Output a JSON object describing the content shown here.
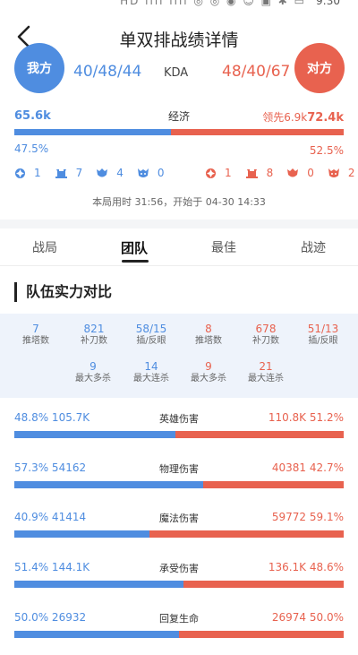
{
  "status_bar": {
    "time": "9:30",
    "icons": "HD ııll ııll ◎ ◎ ◉ ☺ ▣ ✱ ▭"
  },
  "nav": {
    "title": "单双排战绩详情"
  },
  "hero": {
    "ours_label": "我方",
    "theirs_label": "对方",
    "ours_kda": "40/48/44",
    "theirs_kda": "48/40/67",
    "kda_label": "KDA"
  },
  "economy": {
    "label": "经济",
    "ours_value": "65.6k",
    "lead_text": "领先6.9k",
    "theirs_value": "72.4k",
    "ours_pct": "47.5%",
    "theirs_pct": "52.5%",
    "ours_fraction": 0.475
  },
  "objectives": {
    "ours": [
      "1",
      "7",
      "4",
      "0"
    ],
    "theirs": [
      "1",
      "8",
      "0",
      "2"
    ],
    "icon_names": [
      "tyrant-icon",
      "tower-icon",
      "dragon-icon",
      "overlord-icon"
    ]
  },
  "duration_text": "本局用时 31:56，开始于 04-30 14:33",
  "tabs": [
    {
      "label": "战局",
      "active": false
    },
    {
      "label": "团队",
      "active": true
    },
    {
      "label": "最佳",
      "active": false
    },
    {
      "label": "战迹",
      "active": false
    }
  ],
  "section_title": "队伍实力对比",
  "stats": {
    "row1": [
      {
        "value": "7",
        "label": "推塔数",
        "side": "ours"
      },
      {
        "value": "821",
        "label": "补刀数",
        "side": "ours"
      },
      {
        "value": "58/15",
        "label": "插/反眼",
        "side": "ours"
      },
      {
        "value": "8",
        "label": "推塔数",
        "side": "theirs"
      },
      {
        "value": "678",
        "label": "补刀数",
        "side": "theirs"
      },
      {
        "value": "51/13",
        "label": "插/反眼",
        "side": "theirs"
      }
    ],
    "row2": [
      {
        "value": "9",
        "label": "最大多杀",
        "side": "ours"
      },
      {
        "value": "14",
        "label": "最大连杀",
        "side": "ours"
      },
      {
        "value": "9",
        "label": "最大多杀",
        "side": "theirs"
      },
      {
        "value": "21",
        "label": "最大连杀",
        "side": "theirs"
      }
    ]
  },
  "comparisons": [
    {
      "label": "英雄伤害",
      "left": "48.8% 105.7K",
      "right": "110.8K 51.2%",
      "ours_fraction": 0.488
    },
    {
      "label": "物理伤害",
      "left": "57.3% 54162",
      "right": "40381 42.7%",
      "ours_fraction": 0.573
    },
    {
      "label": "魔法伤害",
      "left": "40.9% 41414",
      "right": "59772 59.1%",
      "ours_fraction": 0.409
    },
    {
      "label": "承受伤害",
      "left": "51.4% 144.1K",
      "right": "136.1K 48.6%",
      "ours_fraction": 0.514
    },
    {
      "label": "回复生命",
      "left": "50.0% 26932",
      "right": "26974 50.0%",
      "ours_fraction": 0.5
    }
  ],
  "colors": {
    "ours": "#4f8de0",
    "theirs": "#e8624f"
  }
}
